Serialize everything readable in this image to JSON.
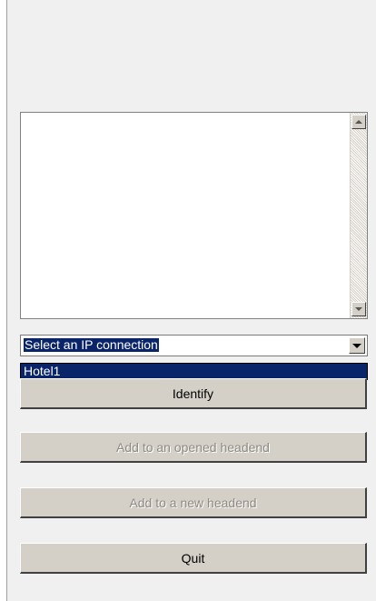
{
  "connection_select": {
    "selected": "Select an IP connection",
    "options": [
      "Hotel1"
    ]
  },
  "buttons": {
    "identify": "Identify",
    "add_opened": "Add to an opened headend",
    "add_new": "Add to a new headend",
    "quit": "Quit"
  },
  "icons": {
    "scroll_up": "triangle-up",
    "scroll_down": "triangle-down",
    "dropdown": "triangle-down"
  },
  "colors": {
    "selection": "#0a246a",
    "button_face": "#d4d0c8",
    "disabled_text": "#8e8a83"
  }
}
